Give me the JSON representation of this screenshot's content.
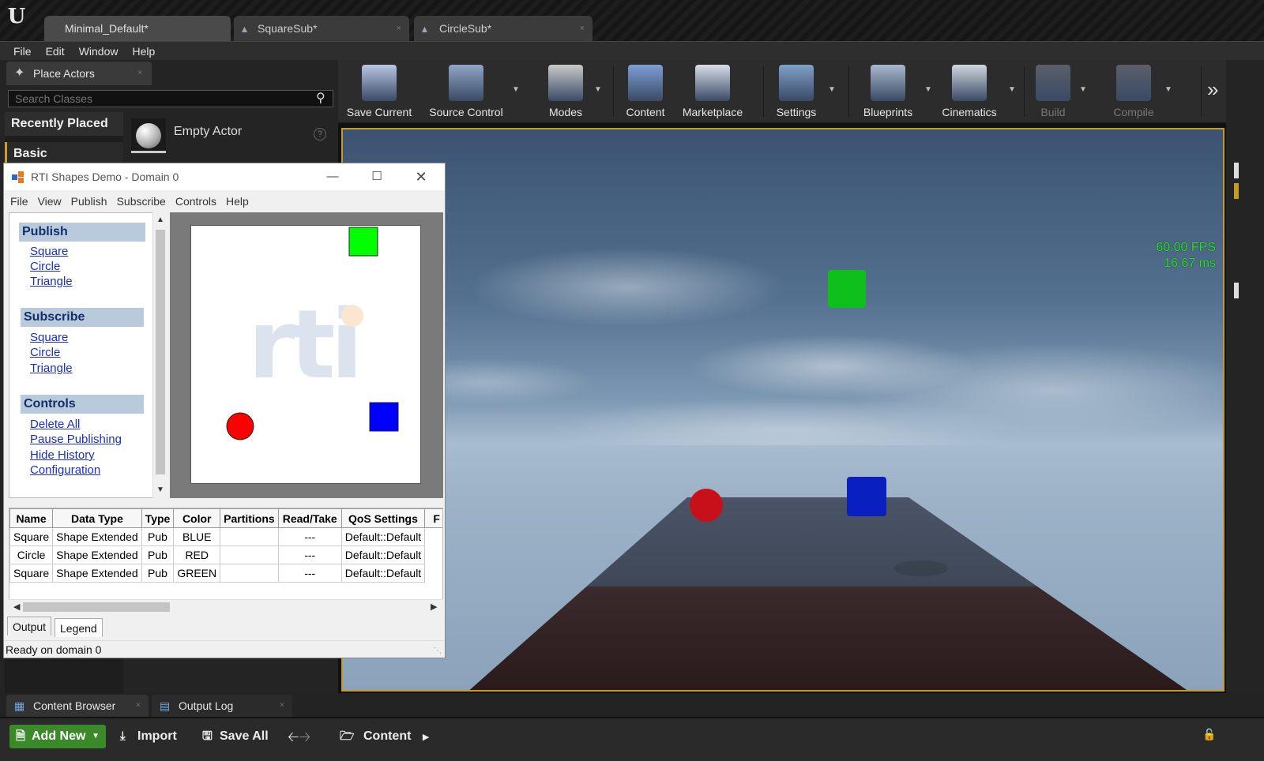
{
  "editor": {
    "logo": "U",
    "tabs": [
      {
        "label": "Minimal_Default",
        "close": ""
      },
      {
        "label": "SquareSub",
        "close": "×"
      },
      {
        "label": "CircleSub",
        "close": "×"
      }
    ],
    "menu": [
      "File",
      "Edit",
      "Window",
      "Help"
    ]
  },
  "place_actors": {
    "tab_label": "Place Actors",
    "search_placeholder": "Search Classes",
    "categories": [
      "Recently Placed",
      "Basic"
    ],
    "item_label": "Empty Actor"
  },
  "toolbar": {
    "buttons": [
      {
        "label": "Save Current",
        "icon": "save-icon",
        "disabled": false
      },
      {
        "label": "Source Control",
        "icon": "source-control-icon",
        "disabled": false
      },
      {
        "label": "Modes",
        "icon": "modes-icon",
        "disabled": false
      },
      {
        "label": "Content",
        "icon": "content-icon",
        "disabled": false
      },
      {
        "label": "Marketplace",
        "icon": "marketplace-icon",
        "disabled": false
      },
      {
        "label": "Settings",
        "icon": "settings-icon",
        "disabled": false
      },
      {
        "label": "Blueprints",
        "icon": "blueprints-icon",
        "disabled": false
      },
      {
        "label": "Cinematics",
        "icon": "cinematics-icon",
        "disabled": false
      },
      {
        "label": "Build",
        "icon": "build-icon",
        "disabled": true
      },
      {
        "label": "Compile",
        "icon": "compile-icon",
        "disabled": true
      }
    ],
    "more": "»"
  },
  "viewport": {
    "fps": "60.00 FPS",
    "ms": "16.67 ms",
    "objects": [
      {
        "shape": "cube",
        "color": "#0fbf1b"
      },
      {
        "shape": "sphere",
        "color": "#c8101a"
      },
      {
        "shape": "cube",
        "color": "#0a1fc0"
      }
    ]
  },
  "rti": {
    "title": "RTI Shapes Demo - Domain 0",
    "menu": [
      "File",
      "View",
      "Publish",
      "Subscribe",
      "Controls",
      "Help"
    ],
    "nav": {
      "publish": {
        "heading": "Publish",
        "links": [
          "Square",
          "Circle",
          "Triangle"
        ]
      },
      "subscribe": {
        "heading": "Subscribe",
        "links": [
          "Square",
          "Circle",
          "Triangle"
        ]
      },
      "controls": {
        "heading": "Controls",
        "links": [
          "Delete All",
          "Pause Publishing",
          "Hide History",
          "Configuration"
        ]
      }
    },
    "watermark": "rti",
    "canvas_shapes": [
      {
        "shape": "square",
        "color": "#00ff00"
      },
      {
        "shape": "circle",
        "color": "#ff0000"
      },
      {
        "shape": "square",
        "color": "#0000ff"
      }
    ],
    "table": {
      "columns": [
        "Name",
        "Data Type",
        "Type",
        "Color",
        "Partitions",
        "Read/Take",
        "QoS Settings",
        "F"
      ],
      "rows": [
        [
          "Square",
          "Shape Extended",
          "Pub",
          "BLUE",
          "",
          "---",
          "Default::Default"
        ],
        [
          "Circle",
          "Shape Extended",
          "Pub",
          "RED",
          "",
          "---",
          "Default::Default"
        ],
        [
          "Square",
          "Shape Extended",
          "Pub",
          "GREEN",
          "",
          "---",
          "Default::Default"
        ]
      ]
    },
    "bottom_tabs": [
      "Output",
      "Legend"
    ],
    "status": "Ready on domain 0"
  },
  "content_browser": {
    "tabs": [
      "Content Browser",
      "Output Log"
    ],
    "add_new": "Add New",
    "import": "Import",
    "save_all": "Save All",
    "path": "Content"
  },
  "colors": {
    "accent_orange": "#c49a2a",
    "add_new_green": "#3a8a2a",
    "fps_green": "#2be02b",
    "link_blue": "#1a2ecc",
    "nav_header": "#b8cadc"
  }
}
